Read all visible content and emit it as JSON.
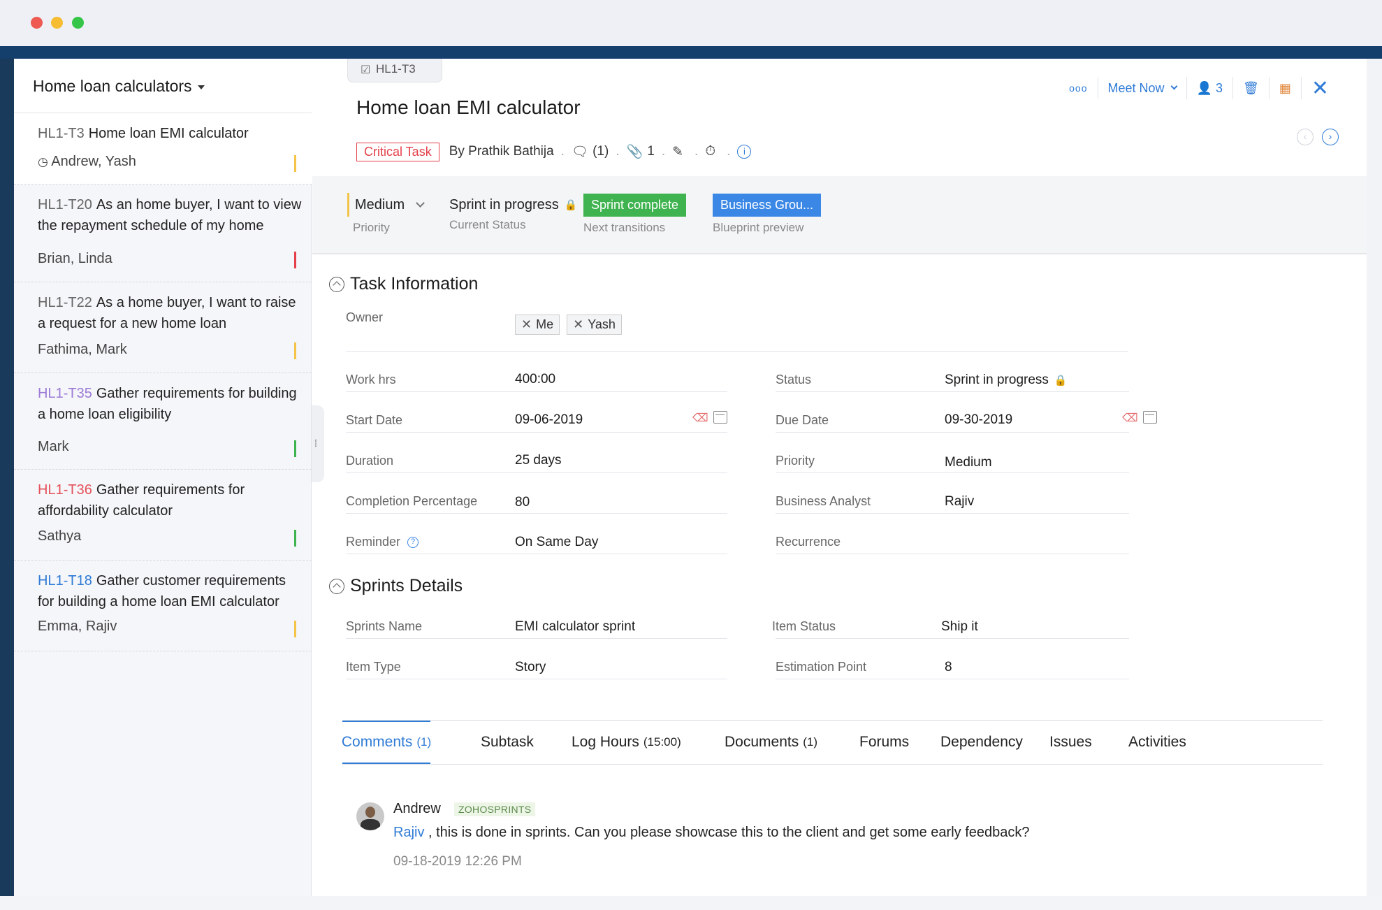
{
  "sidebar": {
    "title": "Home loan calculators",
    "items": [
      {
        "id": "HL1-T3",
        "title": "Home loan EMI calculator",
        "owners": "Andrew, Yash",
        "prio_color": "#f4c34a"
      },
      {
        "id": "HL1-T20",
        "title": "As an home buyer, I want to view the repayment schedule of my home",
        "owners": "Brian, Linda",
        "prio_color": "#e4414a"
      },
      {
        "id": "HL1-T22",
        "title": "As a home buyer, I want to raise a request for a new home loan",
        "owners": "Fathima, Mark",
        "prio_color": "#f4c34a"
      },
      {
        "id": "HL1-T35",
        "title": "Gather requirements for building a home loan eligibility",
        "owners": "Mark",
        "prio_color": "#3fb34f"
      },
      {
        "id": "HL1-T36",
        "title": "Gather requirements for affordability calculator",
        "owners": "Sathya",
        "prio_color": "#3fb34f"
      },
      {
        "id": "HL1-T18",
        "title": "Gather customer requirements for building a home loan EMI calculator",
        "owners": "Emma, Rajiv",
        "prio_color": "#f4c34a"
      }
    ]
  },
  "task": {
    "id": "HL1-T3",
    "title": "Home loan EMI calculator",
    "badge": "Critical Task",
    "author": "By Prathik Bathija",
    "comments_count": "(1)",
    "attachments_count": "1",
    "followers_count": "3",
    "meet_now": "Meet Now"
  },
  "status_band": {
    "priority_value": "Medium",
    "priority_label": "Priority",
    "status_value": "Sprint in progress",
    "status_label": "Current Status",
    "transition_button": "Sprint complete",
    "transition_label": "Next transitions",
    "blueprint_button": "Business Grou...",
    "blueprint_label": "Blueprint preview"
  },
  "task_info": {
    "section_title": "Task Information",
    "owner_label": "Owner",
    "owners": [
      "Me",
      "Yash"
    ],
    "work_hrs_label": "Work hrs",
    "work_hrs": "400:00",
    "status_label": "Status",
    "status": "Sprint in progress",
    "start_date_label": "Start Date",
    "start_date": "09-06-2019",
    "due_date_label": "Due Date",
    "due_date": "09-30-2019",
    "duration_label": "Duration",
    "duration": "25 days",
    "priority_label": "Priority",
    "priority": "Medium",
    "completion_label": "Completion Percentage",
    "completion": "80",
    "analyst_label": "Business Analyst",
    "analyst": "Rajiv",
    "reminder_label": "Reminder",
    "reminder": "On Same Day",
    "recurrence_label": "Recurrence"
  },
  "sprint_details": {
    "section_title": "Sprints Details",
    "sprint_name_label": "Sprints Name",
    "sprint_name": "EMI calculator sprint",
    "item_status_label": "Item Status",
    "item_status": "Ship it",
    "item_type_label": "Item Type",
    "item_type": "Story",
    "estimation_label": "Estimation Point",
    "estimation": "8"
  },
  "tabs": [
    {
      "label": "Comments",
      "count": "(1)"
    },
    {
      "label": "Subtask",
      "count": ""
    },
    {
      "label": "Log Hours",
      "count": "(15:00)"
    },
    {
      "label": "Documents",
      "count": "(1)"
    },
    {
      "label": "Forums",
      "count": ""
    },
    {
      "label": "Dependency",
      "count": ""
    },
    {
      "label": "Issues",
      "count": ""
    },
    {
      "label": "Activities",
      "count": ""
    }
  ],
  "comment": {
    "author": "Andrew",
    "tag": "ZOHOSPRINTS",
    "mention": "Rajiv",
    "text": " , this is done in sprints. Can you please showcase this to the client and get some early feedback?",
    "time": "09-18-2019 12:26 PM"
  }
}
